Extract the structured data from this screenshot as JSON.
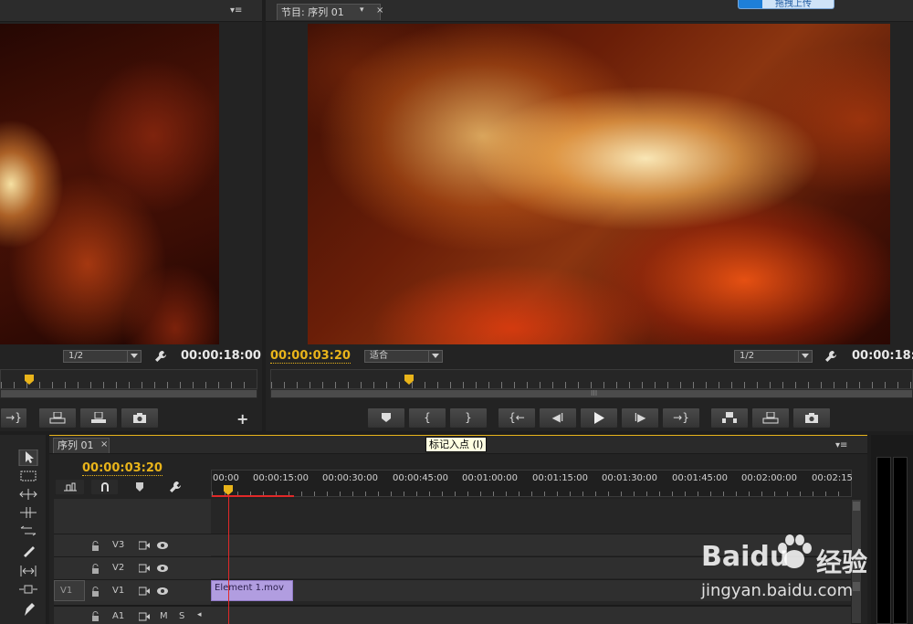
{
  "source_monitor": {
    "zoom": "1/2",
    "timecode": "00:00:18:00"
  },
  "program_monitor": {
    "tab_label": "节目: 序列 01",
    "zoom_fit": "适合",
    "zoom": "1/2",
    "current_timecode": "00:00:03:20",
    "duration_timecode": "00:00:18:0",
    "buttons": [
      "marker",
      "mark-in",
      "mark-out",
      "go-to-in",
      "step-back",
      "play",
      "step-forward",
      "go-to-out",
      "lift",
      "extract",
      "export-frame"
    ],
    "playhead_position": 0.22
  },
  "upload_badge": {
    "label": "拖拽上传"
  },
  "tooltip": {
    "text": "标记入点 (I)"
  },
  "timeline": {
    "tab_label": "序列 01",
    "timecode": "00:00:03:20",
    "ruler_labels": [
      "00:00",
      "00:00:15:00",
      "00:00:30:00",
      "00:00:45:00",
      "00:01:00:00",
      "00:01:15:00",
      "00:01:30:00",
      "00:01:45:00",
      "00:02:00:00",
      "00:02:15"
    ],
    "tracks": [
      {
        "name": "V3",
        "source": ""
      },
      {
        "name": "V2",
        "source": ""
      },
      {
        "name": "V1",
        "source": "V1"
      },
      {
        "name": "A1",
        "source": "",
        "m": "M",
        "s": "S"
      }
    ],
    "clip": {
      "name": "Element 1.mov",
      "color": "#b19de0"
    }
  },
  "watermark": {
    "brand": "Baidu",
    "brand_cn": "经验",
    "url": "jingyan.baidu.com"
  },
  "colors": {
    "accent_timecode": "#e9b41a",
    "playhead_line": "#e02828",
    "clip": "#b19de0"
  }
}
